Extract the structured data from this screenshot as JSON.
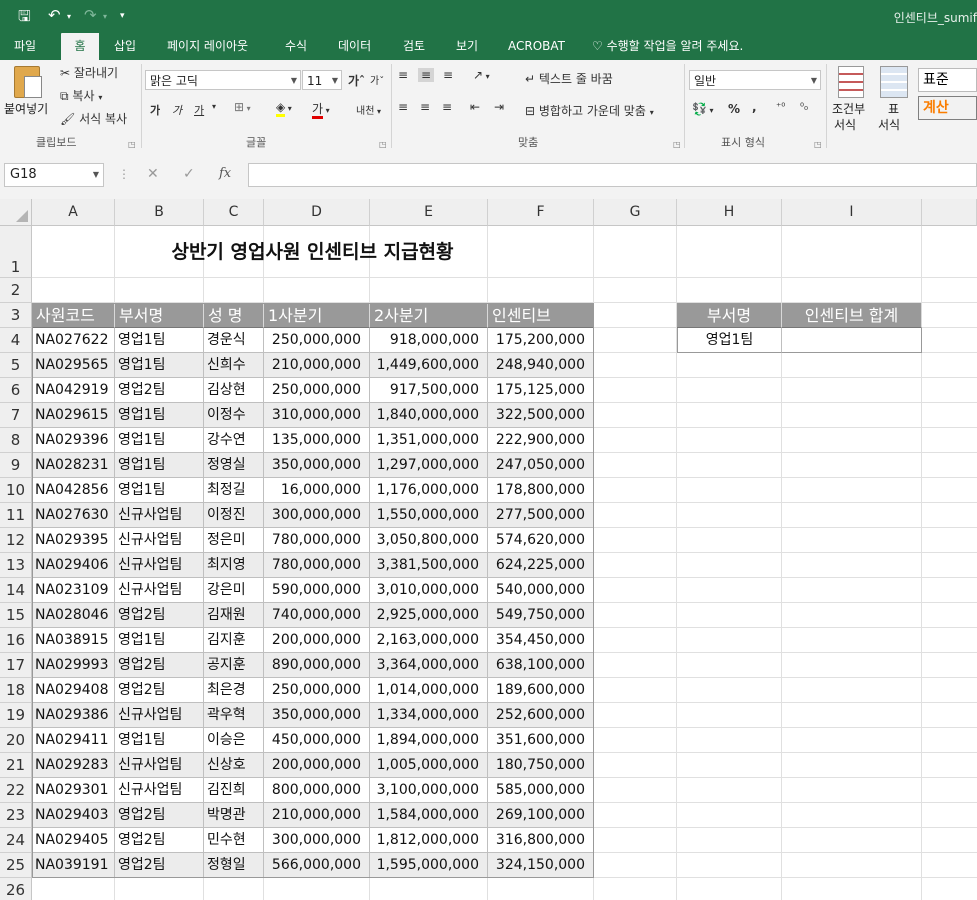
{
  "window": {
    "title": "인센티브_sumif"
  },
  "quick_access": {
    "save_icon": "save-icon",
    "undo_icon": "undo-icon",
    "redo_icon": "redo-icon",
    "customize_icon": "chevron-down-icon"
  },
  "ribbon_tabs": [
    {
      "label": "파일",
      "active": false
    },
    {
      "label": "홈",
      "active": true
    },
    {
      "label": "삽입",
      "active": false
    },
    {
      "label": "페이지 레이아웃",
      "active": false
    },
    {
      "label": "수식",
      "active": false
    },
    {
      "label": "데이터",
      "active": false
    },
    {
      "label": "검토",
      "active": false
    },
    {
      "label": "보기",
      "active": false
    },
    {
      "label": "ACROBAT",
      "active": false
    }
  ],
  "tell_me": "수행할 작업을 알려 주세요.",
  "clipboard": {
    "paste": "붙여넣기",
    "cut": "잘라내기",
    "copy": "복사",
    "format_painter": "서식 복사",
    "group_label": "클립보드"
  },
  "font": {
    "name": "맑은 고딕",
    "size": "11",
    "group_label": "글꼴",
    "bold": "가",
    "italic": "가",
    "underline": "가",
    "phonetic": "내천"
  },
  "alignment": {
    "wrap_text": "텍스트 줄 바꿈",
    "merge_center": "병합하고 가운데 맞춤",
    "group_label": "맞춤"
  },
  "number": {
    "format": "일반",
    "percent": "%",
    "comma": ",",
    "group_label": "표시 형식"
  },
  "styles": {
    "conditional": "조건부",
    "conditional2": "서식",
    "table": "표",
    "table2": "서식",
    "style_normal": "표준",
    "style_calc": "계산"
  },
  "formula_bar": {
    "name_box": "G18",
    "fx": "fx",
    "cancel": "✕",
    "enter": "✓",
    "formula": ""
  },
  "columns": [
    "A",
    "B",
    "C",
    "D",
    "E",
    "F",
    "G",
    "H",
    "I"
  ],
  "rows": [
    "1",
    "2",
    "3",
    "4",
    "5",
    "6",
    "7",
    "8",
    "9",
    "10",
    "11",
    "12",
    "13",
    "14",
    "15",
    "16",
    "17",
    "18",
    "19",
    "20",
    "21",
    "22",
    "23",
    "24",
    "25",
    "26"
  ],
  "sheet": {
    "title": "상반기 영업사원 인센티브 지급현황",
    "headers": [
      "사원코드",
      "부서명",
      "성  명",
      "1사분기",
      "2사분기",
      "인센티브"
    ],
    "rows": [
      [
        "NA027622",
        "영업1팀",
        "경운식",
        "250,000,000",
        "918,000,000",
        "175,200,000"
      ],
      [
        "NA029565",
        "영업1팀",
        "신희수",
        "210,000,000",
        "1,449,600,000",
        "248,940,000"
      ],
      [
        "NA042919",
        "영업2팀",
        "김상현",
        "250,000,000",
        "917,500,000",
        "175,125,000"
      ],
      [
        "NA029615",
        "영업1팀",
        "이정수",
        "310,000,000",
        "1,840,000,000",
        "322,500,000"
      ],
      [
        "NA029396",
        "영업1팀",
        "강수연",
        "135,000,000",
        "1,351,000,000",
        "222,900,000"
      ],
      [
        "NA028231",
        "영업1팀",
        "정영실",
        "350,000,000",
        "1,297,000,000",
        "247,050,000"
      ],
      [
        "NA042856",
        "영업1팀",
        "최정길",
        "16,000,000",
        "1,176,000,000",
        "178,800,000"
      ],
      [
        "NA027630",
        "신규사업팀",
        "이정진",
        "300,000,000",
        "1,550,000,000",
        "277,500,000"
      ],
      [
        "NA029395",
        "신규사업팀",
        "정은미",
        "780,000,000",
        "3,050,800,000",
        "574,620,000"
      ],
      [
        "NA029406",
        "신규사업팀",
        "최지영",
        "780,000,000",
        "3,381,500,000",
        "624,225,000"
      ],
      [
        "NA023109",
        "신규사업팀",
        "강은미",
        "590,000,000",
        "3,010,000,000",
        "540,000,000"
      ],
      [
        "NA028046",
        "영업2팀",
        "김재원",
        "740,000,000",
        "2,925,000,000",
        "549,750,000"
      ],
      [
        "NA038915",
        "영업1팀",
        "김지훈",
        "200,000,000",
        "2,163,000,000",
        "354,450,000"
      ],
      [
        "NA029993",
        "영업2팀",
        "공지훈",
        "890,000,000",
        "3,364,000,000",
        "638,100,000"
      ],
      [
        "NA029408",
        "영업2팀",
        "최은경",
        "250,000,000",
        "1,014,000,000",
        "189,600,000"
      ],
      [
        "NA029386",
        "신규사업팀",
        "곽우혁",
        "350,000,000",
        "1,334,000,000",
        "252,600,000"
      ],
      [
        "NA029411",
        "영업1팀",
        "이승은",
        "450,000,000",
        "1,894,000,000",
        "351,600,000"
      ],
      [
        "NA029283",
        "신규사업팀",
        "신상호",
        "200,000,000",
        "1,005,000,000",
        "180,750,000"
      ],
      [
        "NA029301",
        "신규사업팀",
        "김진희",
        "800,000,000",
        "3,100,000,000",
        "585,000,000"
      ],
      [
        "NA029403",
        "영업2팀",
        "박명관",
        "210,000,000",
        "1,584,000,000",
        "269,100,000"
      ],
      [
        "NA029405",
        "영업2팀",
        "민수현",
        "300,000,000",
        "1,812,000,000",
        "316,800,000"
      ],
      [
        "NA039191",
        "영업2팀",
        "정형일",
        "566,000,000",
        "1,595,000,000",
        "324,150,000"
      ]
    ],
    "summary": {
      "header_dept": "부서명",
      "header_total": "인센티브 합계",
      "dept": "영업1팀",
      "total": ""
    }
  },
  "colors": {
    "excel_green": "#217346",
    "header_gray": "#999999",
    "band_gray": "#ececec"
  }
}
